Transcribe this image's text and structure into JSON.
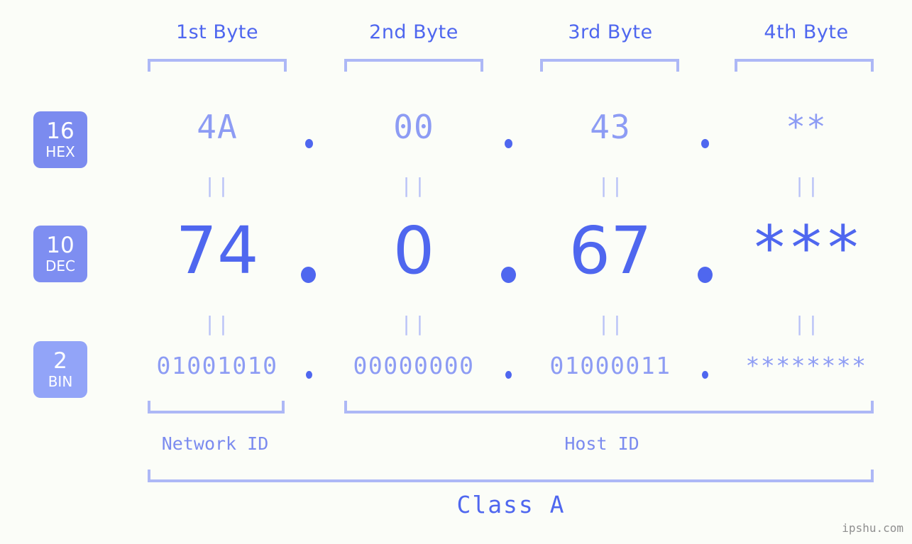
{
  "meta": {
    "background_color": "#fbfdf8",
    "accent_color": "#4f67ef",
    "muted_accent_color": "#8d9cf4",
    "bracket_color": "#adb8f6",
    "badge_color": "#7b8bef",
    "watermark": "ipshu.com"
  },
  "byte_headers": [
    {
      "label": "1st Byte"
    },
    {
      "label": "2nd Byte"
    },
    {
      "label": "3rd Byte"
    },
    {
      "label": "4th Byte"
    }
  ],
  "bases": [
    {
      "number": "16",
      "name": "HEX"
    },
    {
      "number": "10",
      "name": "DEC"
    },
    {
      "number": "2",
      "name": "BIN"
    }
  ],
  "rows": {
    "hex": {
      "values": [
        "4A",
        "00",
        "43",
        "**"
      ]
    },
    "dec": {
      "values": [
        "74",
        "0",
        "67",
        "***"
      ]
    },
    "bin": {
      "values": [
        "01001010",
        "00000000",
        "01000011",
        "********"
      ]
    }
  },
  "separators": {
    "dot": ".",
    "equals": "||"
  },
  "sections": {
    "network_id": "Network ID",
    "host_id": "Host ID",
    "class": "Class A"
  }
}
